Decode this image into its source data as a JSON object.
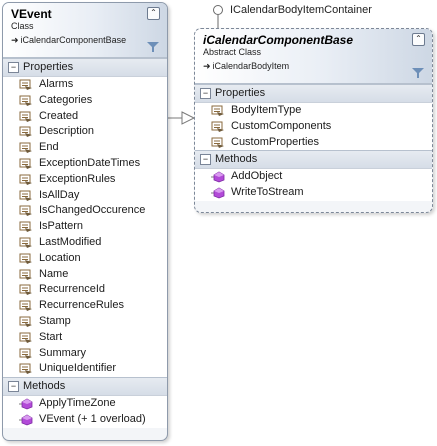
{
  "vevent": {
    "name": "VEvent",
    "kind": "Class",
    "base": "iCalendarComponentBase",
    "properties_label": "Properties",
    "properties": [
      "Alarms",
      "Categories",
      "Created",
      "Description",
      "End",
      "ExceptionDateTimes",
      "ExceptionRules",
      "IsAllDay",
      "IsChangedOccurence",
      "IsPattern",
      "LastModified",
      "Location",
      "Name",
      "RecurrenceId",
      "RecurrenceRules",
      "Stamp",
      "Start",
      "Summary",
      "UniqueIdentifier"
    ],
    "methods_label": "Methods",
    "methods": [
      "ApplyTimeZone",
      "VEvent (+ 1 overload)"
    ]
  },
  "base_class": {
    "name": "iCalendarComponentBase",
    "kind": "Abstract Class",
    "base": "iCalendarBodyItem",
    "properties_label": "Properties",
    "properties": [
      "BodyItemType",
      "CustomComponents",
      "CustomProperties"
    ],
    "methods_label": "Methods",
    "methods": [
      "AddObject",
      "WriteToStream"
    ]
  },
  "interface_label": "ICalendarBodyItemContainer",
  "glyphs": {
    "collapse": "⌃",
    "section_toggle": "−",
    "inherits_arrow": "➜"
  },
  "colors": {
    "property_icon": "#8a6a3c",
    "method_icon": "#b24ad8",
    "filter_icon": "#6d8fb8"
  }
}
